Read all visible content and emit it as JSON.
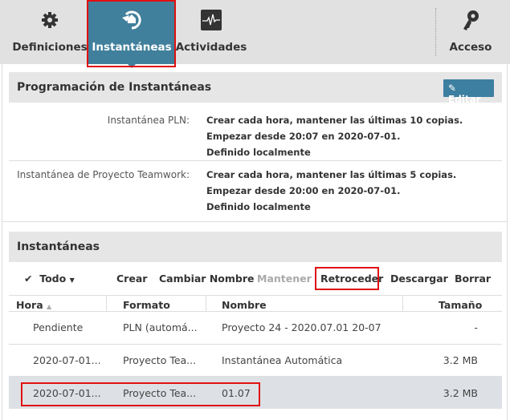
{
  "nav": {
    "tabs": [
      {
        "label": "Definiciones",
        "icon": "gear-icon"
      },
      {
        "label": "Instantáneas",
        "icon": "snapshot-restore-icon",
        "active": true
      },
      {
        "label": "Actividades",
        "icon": "activity-monitor-icon"
      },
      {
        "label": "Acceso",
        "icon": "key-icon"
      }
    ]
  },
  "schedule": {
    "title": "Programación de Instantáneas",
    "edit_label": "Editar",
    "items": [
      {
        "label": "Instantánea PLN:",
        "lines": [
          "Crear cada hora, mantener las últimas 10 copias.",
          "Empezar desde 20:07 en 2020-07-01.",
          "Definido localmente"
        ]
      },
      {
        "label": "Instantánea de Proyecto Teamwork:",
        "lines": [
          "Crear cada hora, mantener las últimas 5 copias.",
          "Empezar desde 20:00 en 2020-07-01.",
          "Definido localmente"
        ]
      }
    ]
  },
  "snapshots": {
    "title": "Instantáneas",
    "toolbar": {
      "select_all": "Todo",
      "create": "Crear",
      "rename": "Cambiar Nombre",
      "keep": "Mantener",
      "rollback": "Retroceder",
      "download": "Descargar",
      "delete": "Borrar"
    },
    "columns": [
      "Hora",
      "Formato",
      "Nombre",
      "Tamaño"
    ],
    "rows": [
      [
        "Pendiente",
        "PLN (automá...",
        "Proyecto 24 - 2020.07.01 20-07",
        "-"
      ],
      [
        "2020-07-01...",
        "Proyecto Tea...",
        "Instantánea Automática",
        "3.2 MB"
      ],
      [
        "2020-07-01...",
        "Proyecto Tea...",
        "01.07",
        "3.2 MB"
      ]
    ]
  },
  "colors": {
    "accent": "#41809c",
    "highlight": "#e01010",
    "selected_row": "#dde1e5"
  }
}
